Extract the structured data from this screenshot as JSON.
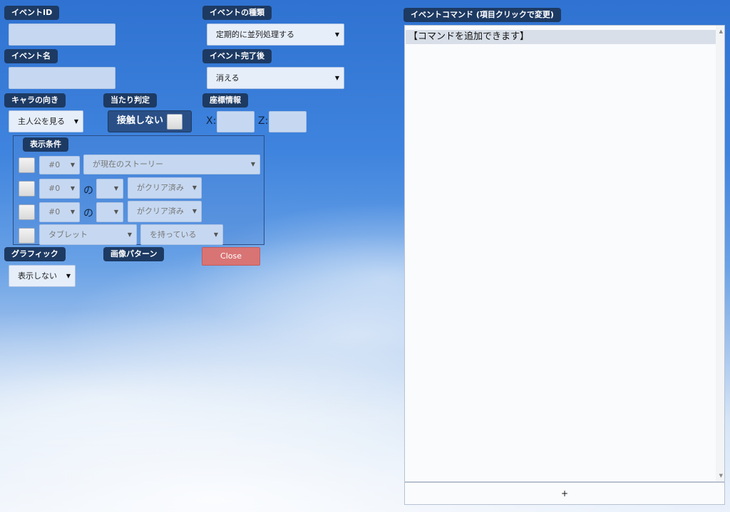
{
  "labels": {
    "event_id": "イベントID",
    "event_type": "イベントの種類",
    "event_name": "イベント名",
    "after_complete": "イベント完了後",
    "chara_direction": "キャラの向き",
    "hit_judge": "当たり判定",
    "coord_info": "座標情報",
    "display_condition": "表示条件",
    "graphic": "グラフィック",
    "image_pattern": "画像パターン",
    "event_command": "イベントコマンド (項目クリックで変更)"
  },
  "fields": {
    "event_type_value": "定期的に並列処理する",
    "after_complete_value": "消える",
    "chara_direction_value": "主人公を見る",
    "hit_judge_value": "接触しない",
    "coord_x_label": "X:",
    "coord_z_label": "Z:",
    "graphic_value": "表示しない"
  },
  "conditions": {
    "row1": {
      "num": "#0",
      "story": "が現在のストーリー"
    },
    "row2": {
      "num": "#0",
      "of": "の",
      "sub": "",
      "status": "がクリア済み"
    },
    "row3": {
      "num": "#0",
      "of": "の",
      "sub": "",
      "status": "がクリア済み"
    },
    "row4": {
      "item": "タブレット",
      "have": "を持っている"
    }
  },
  "buttons": {
    "close": "Close",
    "add": "+"
  },
  "commands": {
    "first": "【コマンドを追加できます】"
  },
  "icons": {
    "dropdown": "▼",
    "scroll_up": "▲",
    "scroll_down": "▼"
  }
}
